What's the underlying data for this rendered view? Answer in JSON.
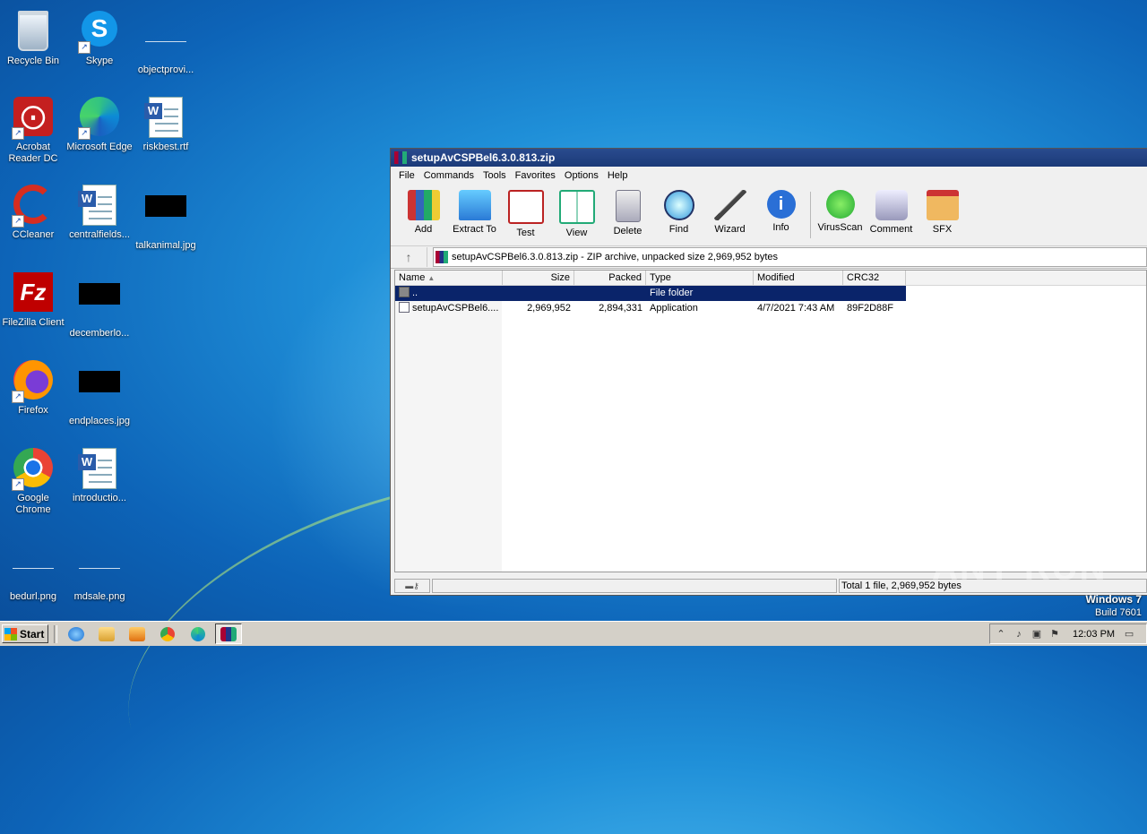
{
  "desktop": {
    "icons": [
      {
        "label": "Recycle Bin"
      },
      {
        "label": "Skype"
      },
      {
        "label": "objectprovi..."
      },
      {
        "label": "Acrobat Reader DC"
      },
      {
        "label": "Microsoft Edge"
      },
      {
        "label": "riskbest.rtf"
      },
      {
        "label": "CCleaner"
      },
      {
        "label": "centralfields..."
      },
      {
        "label": "talkanimal.jpg"
      },
      {
        "label": "FileZilla Client"
      },
      {
        "label": "decemberlo..."
      },
      {
        "label": "Firefox"
      },
      {
        "label": "endplaces.jpg"
      },
      {
        "label": "Google Chrome"
      },
      {
        "label": "introductio..."
      },
      {
        "label": "bedurl.png"
      },
      {
        "label": "mdsale.png"
      }
    ]
  },
  "window": {
    "title": "setupAvCSPBel6.3.0.813.zip",
    "menu": [
      "File",
      "Commands",
      "Tools",
      "Favorites",
      "Options",
      "Help"
    ],
    "toolbar": [
      "Add",
      "Extract To",
      "Test",
      "View",
      "Delete",
      "Find",
      "Wizard",
      "Info",
      "VirusScan",
      "Comment",
      "SFX"
    ],
    "address": "setupAvCSPBel6.3.0.813.zip - ZIP archive, unpacked size 2,969,952 bytes",
    "columns": [
      "Name",
      "Size",
      "Packed",
      "Type",
      "Modified",
      "CRC32"
    ],
    "rows": [
      {
        "name": "..",
        "size": "",
        "packed": "",
        "type": "File folder",
        "modified": "",
        "crc": ""
      },
      {
        "name": "setupAvCSPBel6....",
        "size": "2,969,952",
        "packed": "2,894,331",
        "type": "Application",
        "modified": "4/7/2021 7:43 AM",
        "crc": "89F2D88F"
      }
    ],
    "status": "Total 1 file, 2,969,952 bytes"
  },
  "watermark": "ANY RUN",
  "os": {
    "line1": "Windows 7",
    "line2": "Build 7601"
  },
  "taskbar": {
    "start": "Start",
    "clock": "12:03 PM"
  },
  "colors": {
    "titlebar": "#1b3a78",
    "selection": "#0a246a",
    "taskbar": "#d4d0c8"
  }
}
